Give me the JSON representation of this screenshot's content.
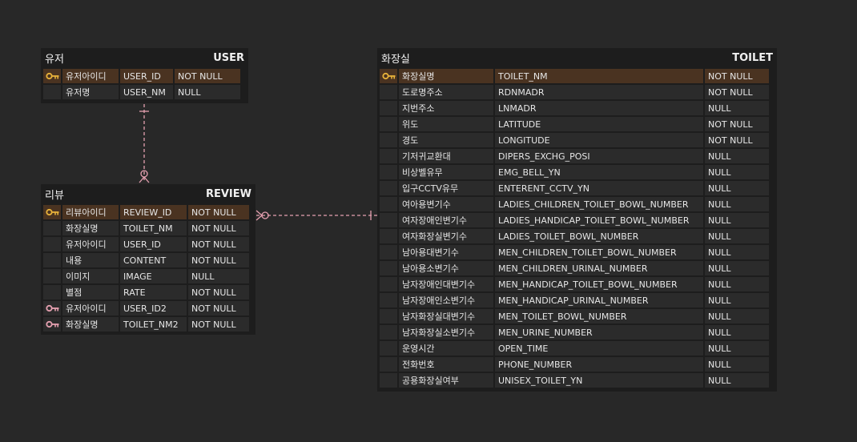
{
  "colors": {
    "background": "#282828",
    "table_bg": "#1d1d1d",
    "cell_bg": "#2b2b2b",
    "pk_row_bg": "#4a3321",
    "pk_key": "#e8b23a",
    "fk_key": "#e5a0b0",
    "relation_line": "#e5a0b0"
  },
  "entities": {
    "user": {
      "logical": "유저",
      "physical": "USER",
      "columns": [
        {
          "logical": "유저아이디",
          "physical": "USER_ID",
          "nullable": "NOT NULL",
          "key": "pk"
        },
        {
          "logical": "유저명",
          "physical": "USER_NM",
          "nullable": "NULL",
          "key": ""
        }
      ]
    },
    "review": {
      "logical": "리뷰",
      "physical": "REVIEW",
      "columns": [
        {
          "logical": "리뷰아이디",
          "physical": "REVIEW_ID",
          "nullable": "NOT NULL",
          "key": "pk"
        },
        {
          "logical": "화장실명",
          "physical": "TOILET_NM",
          "nullable": "NOT NULL",
          "key": ""
        },
        {
          "logical": "유저아이디",
          "physical": "USER_ID",
          "nullable": "NOT NULL",
          "key": ""
        },
        {
          "logical": "내용",
          "physical": "CONTENT",
          "nullable": "NOT NULL",
          "key": ""
        },
        {
          "logical": "이미지",
          "physical": "IMAGE",
          "nullable": "NULL",
          "key": ""
        },
        {
          "logical": "별점",
          "physical": "RATE",
          "nullable": "NOT NULL",
          "key": ""
        },
        {
          "logical": "유저아이디",
          "physical": "USER_ID2",
          "nullable": "NOT NULL",
          "key": "fk"
        },
        {
          "logical": "화장실명",
          "physical": "TOILET_NM2",
          "nullable": "NOT NULL",
          "key": "fk"
        }
      ]
    },
    "toilet": {
      "logical": "화장실",
      "physical": "TOILET",
      "columns": [
        {
          "logical": "화장실명",
          "physical": "TOILET_NM",
          "nullable": "NOT NULL",
          "key": "pk"
        },
        {
          "logical": "도로명주소",
          "physical": "RDNMADR",
          "nullable": "NOT NULL",
          "key": ""
        },
        {
          "logical": "지번주소",
          "physical": "LNMADR",
          "nullable": "NULL",
          "key": ""
        },
        {
          "logical": "위도",
          "physical": "LATITUDE",
          "nullable": "NOT NULL",
          "key": ""
        },
        {
          "logical": "경도",
          "physical": "LONGITUDE",
          "nullable": "NOT NULL",
          "key": ""
        },
        {
          "logical": "기저귀교환대",
          "physical": "DIPERS_EXCHG_POSI",
          "nullable": "NULL",
          "key": ""
        },
        {
          "logical": "비상벨유무",
          "physical": "EMG_BELL_YN",
          "nullable": "NULL",
          "key": ""
        },
        {
          "logical": "입구CCTV유무",
          "physical": "ENTERENT_CCTV_YN",
          "nullable": "NULL",
          "key": ""
        },
        {
          "logical": "여아용변기수",
          "physical": "LADIES_CHILDREN_TOILET_BOWL_NUMBER",
          "nullable": "NULL",
          "key": ""
        },
        {
          "logical": "여자장애인변기수",
          "physical": "LADIES_HANDICAP_TOILET_BOWL_NUMBER",
          "nullable": "NULL",
          "key": ""
        },
        {
          "logical": "여자화장실변기수",
          "physical": "LADIES_TOILET_BOWL_NUMBER",
          "nullable": "NULL",
          "key": ""
        },
        {
          "logical": "남아용대변기수",
          "physical": "MEN_CHILDREN_TOILET_BOWL_NUMBER",
          "nullable": "NULL",
          "key": ""
        },
        {
          "logical": "남아용소변기수",
          "physical": "MEN_CHILDREN_URINAL_NUMBER",
          "nullable": "NULL",
          "key": ""
        },
        {
          "logical": "남자장애인대변기수",
          "physical": "MEN_HANDICAP_TOILET_BOWL_NUMBER",
          "nullable": "NULL",
          "key": ""
        },
        {
          "logical": "남자장애인소변기수",
          "physical": "MEN_HANDICAP_URINAL_NUMBER",
          "nullable": "NULL",
          "key": ""
        },
        {
          "logical": "남자화장실대변기수",
          "physical": "MEN_TOILET_BOWL_NUMBER",
          "nullable": "NULL",
          "key": ""
        },
        {
          "logical": "남자화장실소변기수",
          "physical": "MEN_URINE_NUMBER",
          "nullable": "NULL",
          "key": ""
        },
        {
          "logical": "운영시간",
          "physical": "OPEN_TIME",
          "nullable": "NULL",
          "key": ""
        },
        {
          "logical": "전화번호",
          "physical": "PHONE_NUMBER",
          "nullable": "NULL",
          "key": ""
        },
        {
          "logical": "공용화장실여부",
          "physical": "UNISEX_TOILET_YN",
          "nullable": "NULL",
          "key": ""
        }
      ]
    }
  }
}
